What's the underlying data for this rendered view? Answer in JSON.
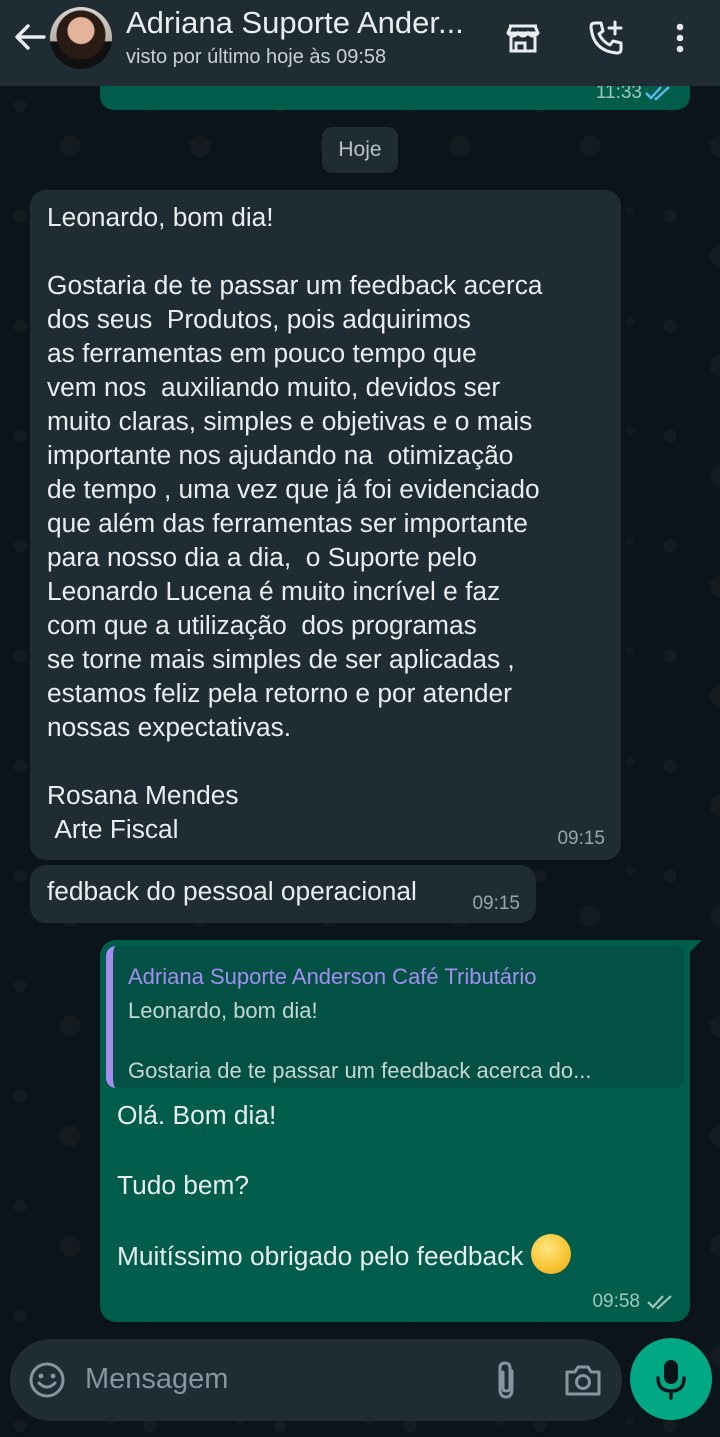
{
  "header": {
    "title": "Adriana Suporte Ander...",
    "subtitle": "visto por último hoje às 09:58",
    "icons": [
      "back-arrow-icon",
      "store-icon",
      "add-call-icon",
      "more-vert-icon"
    ]
  },
  "prev_message": {
    "time": "11:33",
    "status": "read"
  },
  "date_chip": "Hoje",
  "messages": {
    "m1": {
      "text": "Leonardo, bom dia!\n\nGostaria de te passar um feedback acerca\ndos seus  Produtos, pois adquirimos\nas ferramentas em pouco tempo que\nvem nos  auxiliando muito, devidos ser\nmuito claras, simples e objetivas e o mais\nimportante nos ajudando na  otimização\nde tempo , uma vez que já foi evidenciado\nque além das ferramentas ser importante\npara nosso dia a dia,  o Suporte pelo\nLeonardo Lucena é muito incrível e faz\ncom que a utilização  dos programas\nse torne mais simples de ser aplicadas ,\nestamos feliz pela retorno e por atender\nnossas expectativas.\n\nRosana Mendes\n Arte Fiscal",
      "time": "09:15"
    },
    "m2": {
      "text": "fedback do pessoal operacional",
      "time": "09:15"
    },
    "m3": {
      "quote_author": "Adriana Suporte Anderson Café Tributário",
      "quote_line1": "Leonardo, bom dia!",
      "quote_line2": "Gostaria de te passar um feedback acerca do...",
      "line1": "Olá. Bom dia!",
      "line2": "Tudo bem?",
      "line3": "Muitíssimo obrigado pelo feedback",
      "emoji": "smiling-face-emoji",
      "time": "09:58",
      "status": "delivered"
    }
  },
  "input": {
    "placeholder": "Mensagem"
  },
  "colors": {
    "header_bg": "#1f2c34",
    "incoming_bubble": "#202c33",
    "outgoing_bubble": "#005c4b",
    "accent": "#00a884",
    "quote_author": "#a38ef0"
  }
}
